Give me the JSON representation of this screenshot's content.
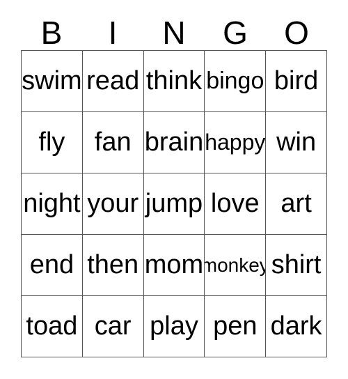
{
  "card": {
    "title": "BINGO",
    "grid_size": 5,
    "colors": {
      "background": "#ffffff",
      "text": "#000000",
      "grid_line": "#555555"
    },
    "header": {
      "letters": [
        "B",
        "I",
        "N",
        "G",
        "O"
      ]
    },
    "rows": [
      {
        "cells": [
          {
            "text": "swim",
            "fit": ""
          },
          {
            "text": "read",
            "fit": ""
          },
          {
            "text": "think",
            "fit": ""
          },
          {
            "text": "bingo",
            "fit": "fit-sm"
          },
          {
            "text": "bird",
            "fit": ""
          }
        ]
      },
      {
        "cells": [
          {
            "text": "fly",
            "fit": ""
          },
          {
            "text": "fan",
            "fit": ""
          },
          {
            "text": "brain",
            "fit": ""
          },
          {
            "text": "happy",
            "fit": "fit-xs"
          },
          {
            "text": "win",
            "fit": ""
          }
        ]
      },
      {
        "cells": [
          {
            "text": "night",
            "fit": ""
          },
          {
            "text": "your",
            "fit": ""
          },
          {
            "text": "jump",
            "fit": ""
          },
          {
            "text": "love",
            "fit": ""
          },
          {
            "text": "art",
            "fit": ""
          }
        ]
      },
      {
        "cells": [
          {
            "text": "end",
            "fit": ""
          },
          {
            "text": "then",
            "fit": ""
          },
          {
            "text": "mom",
            "fit": ""
          },
          {
            "text": "monkey",
            "fit": "fit-xxs"
          },
          {
            "text": "shirt",
            "fit": ""
          }
        ]
      },
      {
        "cells": [
          {
            "text": "toad",
            "fit": ""
          },
          {
            "text": "car",
            "fit": ""
          },
          {
            "text": "play",
            "fit": ""
          },
          {
            "text": "pen",
            "fit": ""
          },
          {
            "text": "dark",
            "fit": ""
          }
        ]
      }
    ]
  }
}
